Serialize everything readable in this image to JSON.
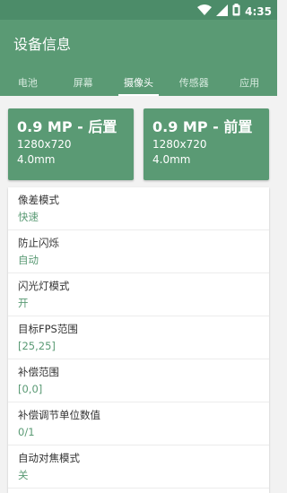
{
  "status_bar": {
    "time": "4:35",
    "icons": [
      "wifi-icon",
      "cell-signal-icon",
      "battery-icon"
    ]
  },
  "app": {
    "title": "设备信息"
  },
  "tabs": [
    {
      "label": "电池",
      "active": false
    },
    {
      "label": "屏幕",
      "active": false
    },
    {
      "label": "摄像头",
      "active": true
    },
    {
      "label": "传感器",
      "active": false
    },
    {
      "label": "应用",
      "active": false
    }
  ],
  "cameras": [
    {
      "title": "0.9 MP - 后置",
      "resolution": "1280x720",
      "focal": "4.0mm"
    },
    {
      "title": "0.9 MP - 前置",
      "resolution": "1280x720",
      "focal": "4.0mm"
    }
  ],
  "details": [
    {
      "label": "像差模式",
      "value": "快速"
    },
    {
      "label": "防止闪烁",
      "value": "自动"
    },
    {
      "label": "闪光灯模式",
      "value": "开"
    },
    {
      "label": "目标FPS范围",
      "value": "[25,25]"
    },
    {
      "label": "补偿范围",
      "value": "[0,0]"
    },
    {
      "label": "补偿调节单位数值",
      "value": "0/1"
    },
    {
      "label": "自动对焦模式",
      "value": "关"
    }
  ],
  "colors": {
    "status_bar": "#4c8c69",
    "app_bar": "#5a9a74",
    "accent": "#5a9a74",
    "background": "#f2f2f2"
  }
}
